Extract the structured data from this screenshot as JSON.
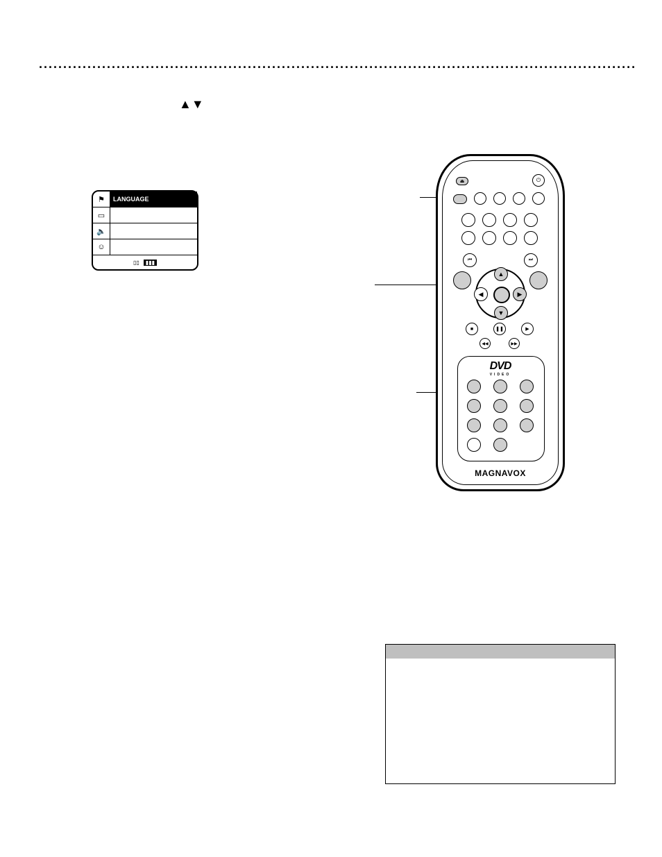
{
  "dotline": "...........................................................................................................................",
  "arrows_glyph": "▲▼",
  "osd": {
    "icon_flag": "⚑",
    "icon_screen": "▭",
    "icon_sound": "🔈",
    "icon_person": "☺",
    "label_language": "LANGUAGE",
    "label_tv_shape": "",
    "sound_value": "",
    "sound_value_sub": "",
    "access_value": "",
    "footer_1": "▯▯",
    "footer_2": "▮▮▮"
  },
  "remote": {
    "brand": "MAGNAVOX",
    "dvd_logo": "DVD",
    "dvd_sub": "VIDEO",
    "glyph_prev": "⏮",
    "glyph_next": "⏭",
    "glyph_stop": "■",
    "glyph_play": "▶",
    "glyph_pause": "❚❚",
    "glyph_rew": "◀◀",
    "glyph_ff": "▶▶",
    "glyph_up": "▲",
    "glyph_down": "▼",
    "glyph_left": "◀",
    "glyph_right": "▶",
    "glyph_power": "⏻",
    "glyph_eject": "⏏"
  }
}
